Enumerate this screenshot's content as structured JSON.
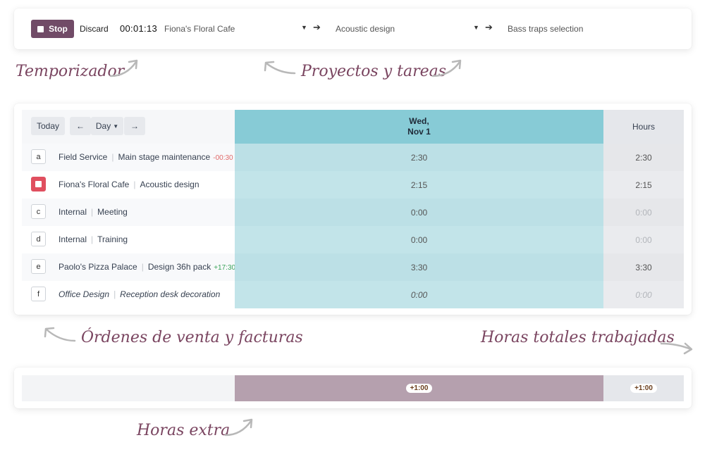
{
  "timer": {
    "stop_label": "Stop",
    "discard_label": "Discard",
    "elapsed": "00:01:13",
    "project": "Fiona's Floral Cafe",
    "task": "Acoustic design",
    "description": "Bass traps selection"
  },
  "annotations": {
    "timer": "Temporizador",
    "projects": "Proyectos y tareas",
    "orders": "Órdenes de venta y facturas",
    "total_hours": "Horas totales trabajadas",
    "overtime": "Horas extra"
  },
  "grid": {
    "today_label": "Today",
    "prev_icon": "←",
    "next_icon": "→",
    "range_label": "Day",
    "day_header": {
      "line1": "Wed,",
      "line2": "Nov 1"
    },
    "hours_header": "Hours",
    "rows": [
      {
        "key": "a",
        "project": "Field Service",
        "task": "Main stage maintenance",
        "badge": "-00:30",
        "badge_type": "negative",
        "day": "2:30",
        "total": "2:30",
        "active": false,
        "italic": false
      },
      {
        "key": "",
        "project": "Fiona's Floral Cafe",
        "task": "Acoustic design",
        "badge": "",
        "badge_type": "",
        "day": "2:15",
        "total": "2:15",
        "active": true,
        "italic": false
      },
      {
        "key": "c",
        "project": "Internal",
        "task": "Meeting",
        "badge": "",
        "badge_type": "",
        "day": "0:00",
        "total": "0:00",
        "active": false,
        "italic": false
      },
      {
        "key": "d",
        "project": "Internal",
        "task": "Training",
        "badge": "",
        "badge_type": "",
        "day": "0:00",
        "total": "0:00",
        "active": false,
        "italic": false
      },
      {
        "key": "e",
        "project": "Paolo's Pizza Palace",
        "task": "Design 36h pack",
        "badge": "+17:30",
        "badge_type": "positive",
        "day": "3:30",
        "total": "3:30",
        "active": false,
        "italic": false
      },
      {
        "key": "f",
        "project": "Office Design",
        "task": "Reception desk decoration",
        "badge": "",
        "badge_type": "",
        "day": "0:00",
        "total": "0:00",
        "active": false,
        "italic": true
      }
    ]
  },
  "overtime": {
    "day": "+1:00",
    "total": "+1:00"
  },
  "colors": {
    "brand": "#714B67",
    "day_header": "#87CBD6",
    "day_cell": "#C2E4E9",
    "overtime_bar": "#B5A0AE",
    "annotation": "#7a4560",
    "active_timer": "#e04f5f"
  }
}
